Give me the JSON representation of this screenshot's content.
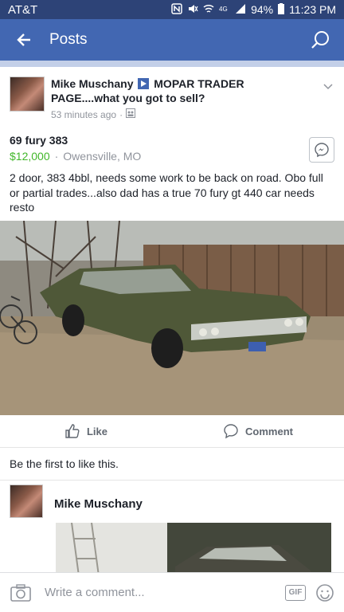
{
  "status": {
    "carrier": "AT&T",
    "battery": "94%",
    "time": "11:23 PM"
  },
  "appbar": {
    "title": "Posts"
  },
  "post": {
    "author": "Mike Muschany",
    "group": "MOPAR TRADER PAGE....what you got to sell?",
    "time": "53 minutes ago",
    "separator": "·",
    "listing_title": "69 fury 383",
    "price": "$12,000",
    "location": "Owensville, MO",
    "description": "2 door, 383 4bbl, needs some work to be back on road. Obo full or partial trades...also dad has a true 70 fury gt 440 car needs resto",
    "like_label": "Like",
    "comment_label": "Comment",
    "likes_text": "Be the first to like this."
  },
  "comment": {
    "author": "Mike Muschany"
  },
  "composer": {
    "placeholder": "Write a comment...",
    "gif_label": "GIF"
  },
  "colors": {
    "brand": "#4267b2",
    "statusbar": "#2d4377",
    "price": "#42b72a"
  }
}
